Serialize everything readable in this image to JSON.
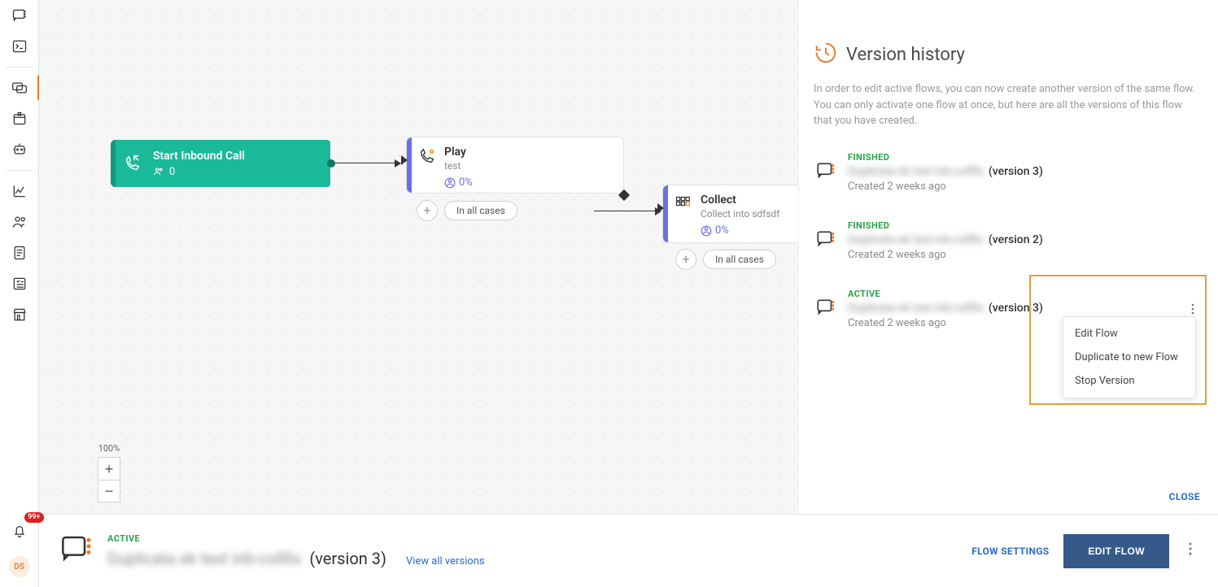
{
  "sidebar": {
    "notif_count": "99+",
    "avatar_initials": "DS"
  },
  "canvas": {
    "zoom_label": "100%",
    "nodes": {
      "start": {
        "title": "Start Inbound Call",
        "count": "0"
      },
      "play": {
        "title": "Play",
        "subtitle": "test",
        "pct": "0%",
        "branch": "In all cases"
      },
      "collect": {
        "title": "Collect",
        "subtitle": "Collect into sdfsdf",
        "pct": "0%",
        "branch": "In all cases"
      }
    }
  },
  "footer": {
    "status": "ACTIVE",
    "name_blurred": "Duplicata ek text inb-collfix",
    "version_suffix": "(version 3)",
    "view_all": "View all versions",
    "settings": "FLOW SETTINGS",
    "edit": "EDIT FLOW"
  },
  "panel": {
    "title": "Version history",
    "desc": "In order to edit active flows, you can now create another version of the same flow. You can only activate one flow at once, but here are all the versions of this flow that you have created.",
    "close": "CLOSE",
    "menu": {
      "edit": "Edit Flow",
      "duplicate": "Duplicate to new Flow",
      "stop": "Stop Version"
    },
    "versions": [
      {
        "status": "FINISHED",
        "name_blurred": "Duplicata ek text inb-collfix",
        "suffix": "(version 3)",
        "created": "Created 2 weeks ago"
      },
      {
        "status": "FINISHED",
        "name_blurred": "Duplicata ek text inb-collfix",
        "suffix": "(version 2)",
        "created": "Created 2 weeks ago"
      },
      {
        "status": "ACTIVE",
        "name_blurred": "Duplicata ek text inb-collfix",
        "suffix": "(version 3)",
        "created": "Created 2 weeks ago"
      }
    ]
  }
}
